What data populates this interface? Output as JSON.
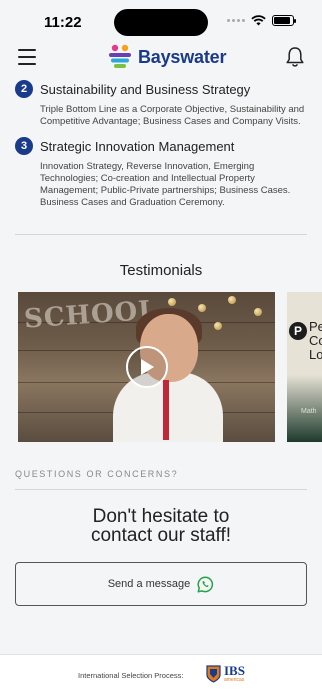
{
  "status_bar": {
    "time": "11:22",
    "battery_level": 0.9
  },
  "header": {
    "brand": "Bayswater"
  },
  "modules": [
    {
      "number": "2",
      "title": "Sustainability and Business Strategy",
      "description": "Triple Bottom Line as a Corporate Objective, Sustainability and Competitive Advantage; Business Cases and Company Visits."
    },
    {
      "number": "3",
      "title": "Strategic Innovation Management",
      "description": "Innovation Strategy, Reverse Innovation, Emerging Technologies; Co-creation and Intellectual Property Management; Public-Private partnerships; Business Cases. Business Cases and Graduation Ceremony."
    }
  ],
  "testimonials": {
    "title": "Testimonials",
    "card1_sign": "SCHOOL",
    "card2_logo": "P",
    "card2_text": "Pe\nCo\nLo",
    "card2_bottom": "Math"
  },
  "contact": {
    "questions_label": "QUESTIONS OR CONCERNS?",
    "title_line1": "Don't hesitate to",
    "title_line2": "contact our staff!",
    "send_label": "Send a message"
  },
  "footer": {
    "label": "International Selection Process:",
    "partner": "IBS",
    "partner_sub": "americas"
  },
  "colors": {
    "brand_blue": "#1a3a8a",
    "whatsapp_green": "#25a244",
    "lanyard_red": "#c0283a"
  }
}
